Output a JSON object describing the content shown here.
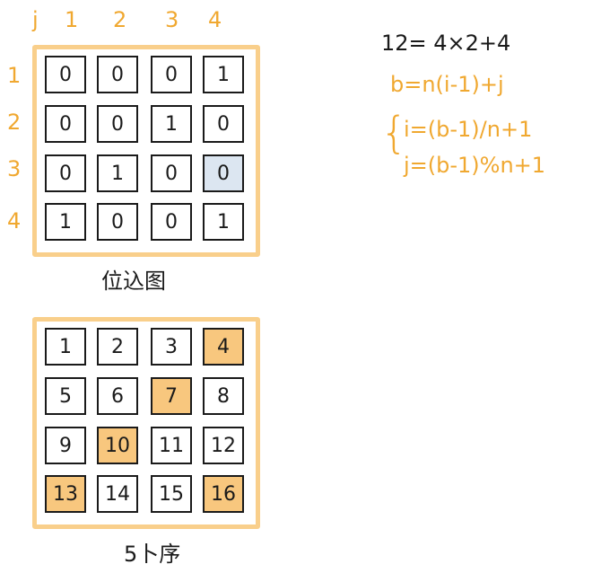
{
  "column_labels": [
    "j",
    "1",
    "2",
    "3",
    "4"
  ],
  "row_labels": [
    "1",
    "2",
    "3",
    "4"
  ],
  "adjacency_matrix": {
    "cells": [
      [
        "0",
        "0",
        "0",
        "1"
      ],
      [
        "0",
        "0",
        "1",
        "0"
      ],
      [
        "0",
        "1",
        "0",
        "0"
      ],
      [
        "1",
        "0",
        "0",
        "1"
      ]
    ],
    "highlighted": [
      [
        2,
        3
      ]
    ],
    "highlight_color": "#dce6f1",
    "caption": "位込图"
  },
  "numbering_grid": {
    "cells": [
      [
        "1",
        "2",
        "3",
        "4"
      ],
      [
        "5",
        "6",
        "7",
        "8"
      ],
      [
        "9",
        "10",
        "11",
        "12"
      ],
      [
        "13",
        "14",
        "15",
        "16"
      ]
    ],
    "highlighted": [
      [
        0,
        3
      ],
      [
        1,
        2
      ],
      [
        2,
        1
      ],
      [
        3,
        0
      ],
      [
        3,
        3
      ]
    ],
    "highlight_color": "#f8c77e",
    "caption": "5卜序"
  },
  "formulas": {
    "line1": "12= 4×2+4",
    "line2": "b=n(i-1)+j",
    "line3": "i=(b-1)/n+1",
    "line4": "j=(b-1)%n+1"
  },
  "colors": {
    "frame": "#f9cf8b",
    "annotation": "#f0a830",
    "ink": "#1a1a1a"
  }
}
